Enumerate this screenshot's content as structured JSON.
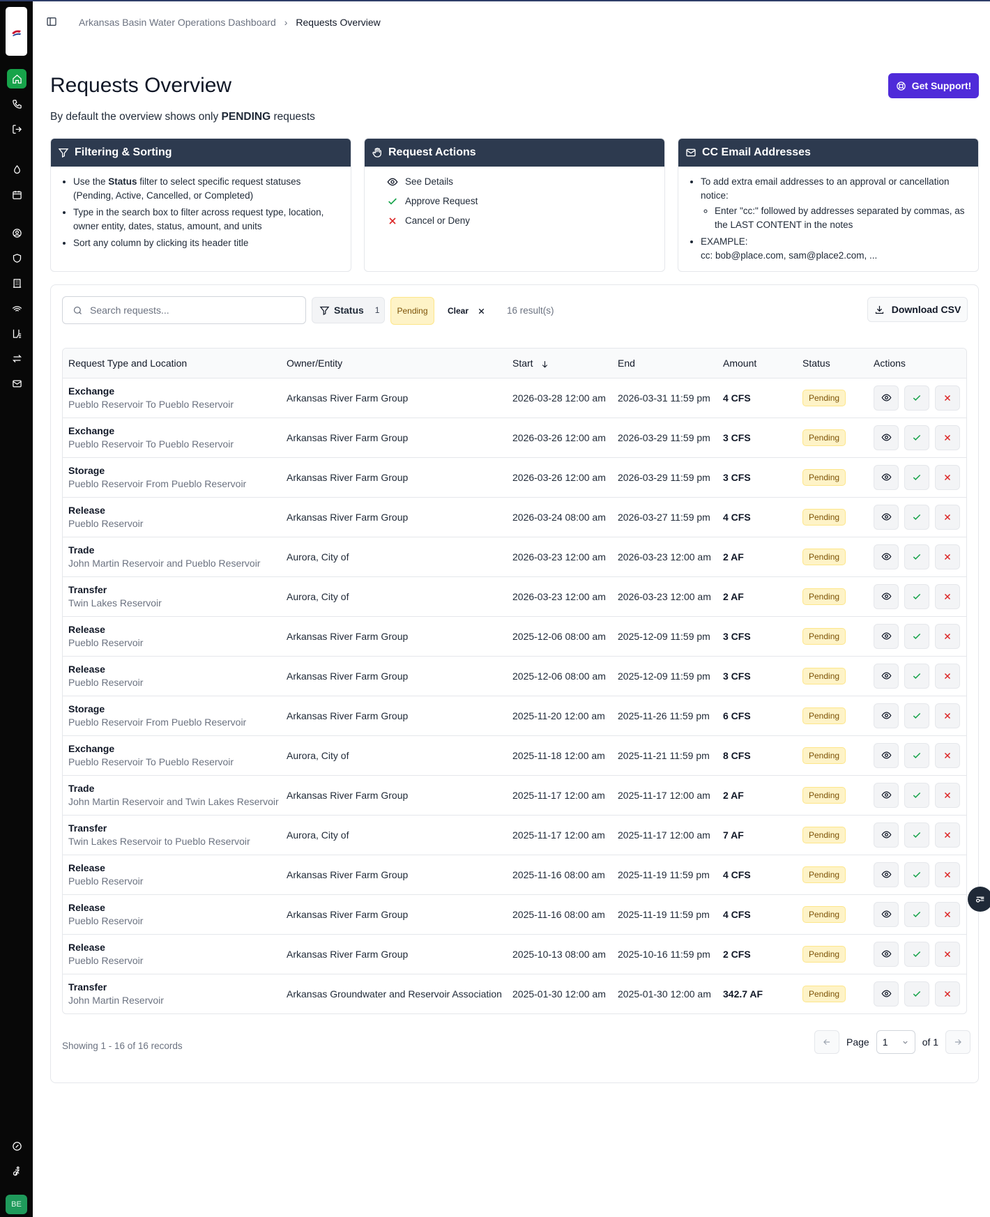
{
  "breadcrumb": {
    "parent": "Arkansas Basin Water Operations Dashboard",
    "current": "Requests Overview"
  },
  "header": {
    "title": "Requests Overview",
    "subtitle_pre": "By default the overview shows only ",
    "subtitle_bold": "PENDING",
    "subtitle_post": " requests",
    "support_label": "Get Support!"
  },
  "cards": {
    "filtering": {
      "title": "Filtering & Sorting",
      "item1_pre": "Use the ",
      "item1_bold": "Status",
      "item1_post": " filter to select specific request statuses (Pending, Active, Cancelled, or Completed)",
      "item2": "Type in the search box to filter across request type, location, owner entity, dates, status, amount, and units",
      "item3": "Sort any column by clicking its header title"
    },
    "actions": {
      "title": "Request Actions",
      "see": "See Details",
      "approve": "Approve Request",
      "cancel": "Cancel or Deny"
    },
    "cc": {
      "title": "CC Email Addresses",
      "item1": "To add extra email addresses to an approval or cancellation notice:",
      "sub1": "Enter \"cc:\" followed by addresses separated by commas, as the LAST CONTENT in the notes",
      "item2": "EXAMPLE:",
      "example": "cc: bob@place.com, sam@place2.com, ..."
    }
  },
  "toolbar": {
    "search_placeholder": "Search requests...",
    "status_label": "Status",
    "status_count": "1",
    "pending_chip": "Pending",
    "clear_label": "Clear",
    "results": "16 result(s)",
    "csv_label": "Download CSV"
  },
  "table": {
    "headers": {
      "type": "Request Type and Location",
      "owner": "Owner/Entity",
      "start": "Start",
      "end": "End",
      "amount": "Amount",
      "status": "Status",
      "actions": "Actions"
    },
    "rows": [
      {
        "type": "Exchange",
        "location": "Pueblo Reservoir To Pueblo Reservoir",
        "owner": "Arkansas River Farm Group",
        "start": "2026-03-28 12:00 am",
        "end": "2026-03-31 11:59 pm",
        "amount": "4 CFS",
        "status": "Pending"
      },
      {
        "type": "Exchange",
        "location": "Pueblo Reservoir To Pueblo Reservoir",
        "owner": "Arkansas River Farm Group",
        "start": "2026-03-26 12:00 am",
        "end": "2026-03-29 11:59 pm",
        "amount": "3 CFS",
        "status": "Pending"
      },
      {
        "type": "Storage",
        "location": "Pueblo Reservoir From Pueblo Reservoir",
        "owner": "Arkansas River Farm Group",
        "start": "2026-03-26 12:00 am",
        "end": "2026-03-29 11:59 pm",
        "amount": "3 CFS",
        "status": "Pending"
      },
      {
        "type": "Release",
        "location": "Pueblo Reservoir",
        "owner": "Arkansas River Farm Group",
        "start": "2026-03-24 08:00 am",
        "end": "2026-03-27 11:59 pm",
        "amount": "4 CFS",
        "status": "Pending"
      },
      {
        "type": "Trade",
        "location": "John Martin Reservoir and Pueblo Reservoir",
        "owner": "Aurora, City of",
        "start": "2026-03-23 12:00 am",
        "end": "2026-03-23 12:00 am",
        "amount": "2 AF",
        "status": "Pending"
      },
      {
        "type": "Transfer",
        "location": "Twin Lakes Reservoir",
        "owner": "Aurora, City of",
        "start": "2026-03-23 12:00 am",
        "end": "2026-03-23 12:00 am",
        "amount": "2 AF",
        "status": "Pending"
      },
      {
        "type": "Release",
        "location": "Pueblo Reservoir",
        "owner": "Arkansas River Farm Group",
        "start": "2025-12-06 08:00 am",
        "end": "2025-12-09 11:59 pm",
        "amount": "3 CFS",
        "status": "Pending"
      },
      {
        "type": "Release",
        "location": "Pueblo Reservoir",
        "owner": "Arkansas River Farm Group",
        "start": "2025-12-06 08:00 am",
        "end": "2025-12-09 11:59 pm",
        "amount": "3 CFS",
        "status": "Pending"
      },
      {
        "type": "Storage",
        "location": "Pueblo Reservoir From Pueblo Reservoir",
        "owner": "Arkansas River Farm Group",
        "start": "2025-11-20 12:00 am",
        "end": "2025-11-26 11:59 pm",
        "amount": "6 CFS",
        "status": "Pending"
      },
      {
        "type": "Exchange",
        "location": "Pueblo Reservoir To Pueblo Reservoir",
        "owner": "Aurora, City of",
        "start": "2025-11-18 12:00 am",
        "end": "2025-11-21 11:59 pm",
        "amount": "8 CFS",
        "status": "Pending"
      },
      {
        "type": "Trade",
        "location": "John Martin Reservoir and Twin Lakes Reservoir",
        "owner": "Arkansas River Farm Group",
        "start": "2025-11-17 12:00 am",
        "end": "2025-11-17 12:00 am",
        "amount": "2 AF",
        "status": "Pending"
      },
      {
        "type": "Transfer",
        "location": "Twin Lakes Reservoir to Pueblo Reservoir",
        "owner": "Aurora, City of",
        "start": "2025-11-17 12:00 am",
        "end": "2025-11-17 12:00 am",
        "amount": "7 AF",
        "status": "Pending"
      },
      {
        "type": "Release",
        "location": "Pueblo Reservoir",
        "owner": "Arkansas River Farm Group",
        "start": "2025-11-16 08:00 am",
        "end": "2025-11-19 11:59 pm",
        "amount": "4 CFS",
        "status": "Pending"
      },
      {
        "type": "Release",
        "location": "Pueblo Reservoir",
        "owner": "Arkansas River Farm Group",
        "start": "2025-11-16 08:00 am",
        "end": "2025-11-19 11:59 pm",
        "amount": "4 CFS",
        "status": "Pending"
      },
      {
        "type": "Release",
        "location": "Pueblo Reservoir",
        "owner": "Arkansas River Farm Group",
        "start": "2025-10-13 08:00 am",
        "end": "2025-10-16 11:59 pm",
        "amount": "2 CFS",
        "status": "Pending"
      },
      {
        "type": "Transfer",
        "location": "John Martin Reservoir",
        "owner": "Arkansas Groundwater and Reservoir Association",
        "start": "2025-01-30 12:00 am",
        "end": "2025-01-30 12:00 am",
        "amount": "342.7 AF",
        "status": "Pending"
      }
    ]
  },
  "footer": {
    "showing": "Showing 1 - 16 of 16 records",
    "page_label": "Page",
    "page_value": "1",
    "of_label": "of 1"
  },
  "user": {
    "initials": "BE"
  },
  "colors": {
    "sidebar_bg": "#080808",
    "active_nav": "#17a34a",
    "card_header": "#2d3a4f",
    "support_button": "#4f2bd9",
    "pending_bg": "#fef3c7",
    "approve": "#16a34a",
    "deny": "#dc2626"
  }
}
